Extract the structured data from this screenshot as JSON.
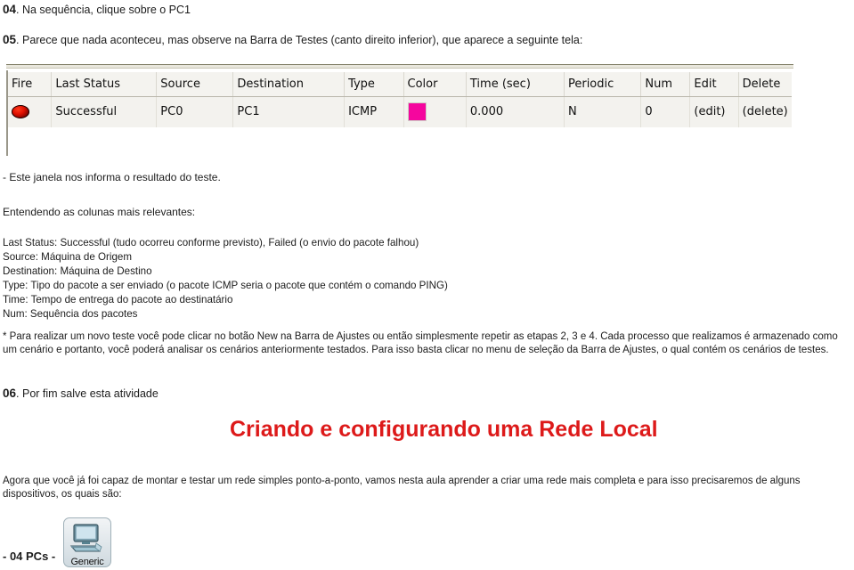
{
  "steps": {
    "s04": {
      "num": "04",
      "text": ". Na sequência, clique sobre o PC1"
    },
    "s05": {
      "num": "05",
      "text": ". Parece que nada aconteceu, mas observe na Barra de Testes (canto direito inferior), que aparece a seguinte tela:"
    },
    "s06": {
      "num": "06",
      "text": ". Por fim salve esta atividade"
    }
  },
  "results_table": {
    "columns": [
      "Fire",
      "Last Status",
      "Source",
      "Destination",
      "Type",
      "Color",
      "Time (sec)",
      "Periodic",
      "Num",
      "Edit",
      "Delete"
    ],
    "rows": [
      {
        "fire": "fire-indicator",
        "last_status": "Successful",
        "source": "PC0",
        "destination": "PC1",
        "type": "ICMP",
        "color": "#f5069e",
        "time_sec": "0.000",
        "periodic": "N",
        "num": "0",
        "edit": "(edit)",
        "delete": "(delete)"
      }
    ]
  },
  "notes": {
    "window_info": "- Este janela nos informa o resultado do teste.",
    "columns_intro": "Entendendo as colunas mais relevantes:",
    "column_defs": "Last Status: Successful (tudo ocorreu conforme previsto), Failed (o envio do pacote falhou)\nSource: Máquina de Origem\nDestination: Máquina de Destino\nType: Tipo do pacote a ser enviado (o pacote ICMP seria o pacote que contém o comando PING)\nTime: Tempo de entrega do pacote ao destinatário\nNum: Sequência dos pacotes",
    "tip_paragraph": "* Para realizar um novo teste você pode clicar no botão New na Barra de Ajustes ou então simplesmente repetir as etapas 2, 3 e 4. Cada processo que realizamos é armazenado como um cenário e portanto, você poderá analisar os cenários anteriormente testados. Para isso basta clicar no menu de seleção da Barra de Ajustes, o qual contém os cenários de testes."
  },
  "section": {
    "title": "Criando e configurando uma Rede Local",
    "title_color": "#dd1a1a",
    "intro": "Agora que você já foi capaz de montar e testar um rede simples ponto-a-ponto, vamos nesta aula aprender a criar uma rede mais completa e para isso precisaremos de alguns dispositivos, os quais são:",
    "device_list_label": "- 04 PCs -",
    "device_icon_label": "Generic"
  }
}
